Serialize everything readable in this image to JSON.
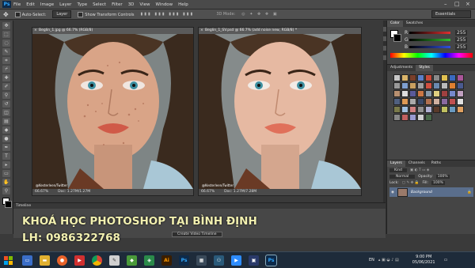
{
  "menubar": {
    "app_logo": "Ps",
    "items": [
      "File",
      "Edit",
      "Image",
      "Layer",
      "Type",
      "Select",
      "Filter",
      "3D",
      "View",
      "Window",
      "Help"
    ]
  },
  "options": {
    "auto_select_label": "Auto-Select:",
    "auto_select_target": "Layer",
    "show_transform_label": "Show Transform Controls",
    "mode_3d_label": "3D Mode:",
    "workspace": "Essentials"
  },
  "documents": [
    {
      "tab_title": "Beglin_1.jpg @ 66.7% (RGB/8)",
      "zoom": "66.67%",
      "doc_info": "Doc: 1.27M/1.27M",
      "credit": "@Kesterleen/Twitter"
    },
    {
      "tab_title": "Beglin_1_SV.psd @ 66.7% (add noise new, RGB/8) *",
      "zoom": "66.67%",
      "doc_info": "Doc: 1.27M/7.28M",
      "credit": "@Kesterleen/Twitter"
    }
  ],
  "color_panel": {
    "tabs": [
      "Color",
      "Swatches"
    ],
    "channels": [
      {
        "label": "R",
        "value": "255",
        "color": "#e03030"
      },
      {
        "label": "G",
        "value": "255",
        "color": "#30c030"
      },
      {
        "label": "B",
        "value": "255",
        "color": "#3050e0"
      }
    ]
  },
  "adjustments_panel": {
    "tabs": [
      "Adjustments",
      "Styles"
    ],
    "swatch_colors": [
      "#c8c8c8",
      "#d9b46a",
      "#7a3f2a",
      "#5a7fc8",
      "#c84a3a",
      "#8a8a8a",
      "#e0c050",
      "#3a6ac0",
      "#aa5599",
      "#999999",
      "#7fa0d0",
      "#c8a060",
      "#a0a0a0",
      "#d05040",
      "#6a8ab0",
      "#bbbbbb",
      "#e08030",
      "#4a5a90",
      "#b89070",
      "#dddddd",
      "#5a5a9a",
      "#cc7744",
      "#8899aa",
      "#e0d080",
      "#a04040",
      "#7788cc",
      "#c0a0c0",
      "#506080",
      "#dd9955",
      "#aaaaaa",
      "#3a4a6a",
      "#b07050",
      "#d0b0a0",
      "#8a6aa0",
      "#c05050",
      "#e0e0e0",
      "#7a7a4a",
      "#a0c0e0",
      "#d08080",
      "#909090",
      "#b0b0d0",
      "#5a3a2a",
      "#c0c060",
      "#6a9ac0",
      "#e0a060",
      "#888888",
      "#c06060",
      "#9a9ad0",
      "#cfcfcf",
      "#4a6a4a"
    ]
  },
  "layers_panel": {
    "tabs": [
      "Layers",
      "Channels",
      "Paths"
    ],
    "kind_label": "Kind",
    "blend_mode": "Normal",
    "opacity_label": "Opacity:",
    "opacity_value": "100%",
    "lock_label": "Lock:",
    "fill_label": "Fill:",
    "fill_value": "100%",
    "layer_name": "Background"
  },
  "timeline": {
    "title": "Timeline",
    "create_button": "Create Video Timeline"
  },
  "overlay": {
    "line1": "KHOÁ HỌC PHOTOSHOP TẠI BÌNH ĐỊNH",
    "line2": "LH: 0986322768"
  },
  "taskbar": {
    "language": "EN",
    "time": "9:00 PM",
    "date": "05/06/2021"
  }
}
